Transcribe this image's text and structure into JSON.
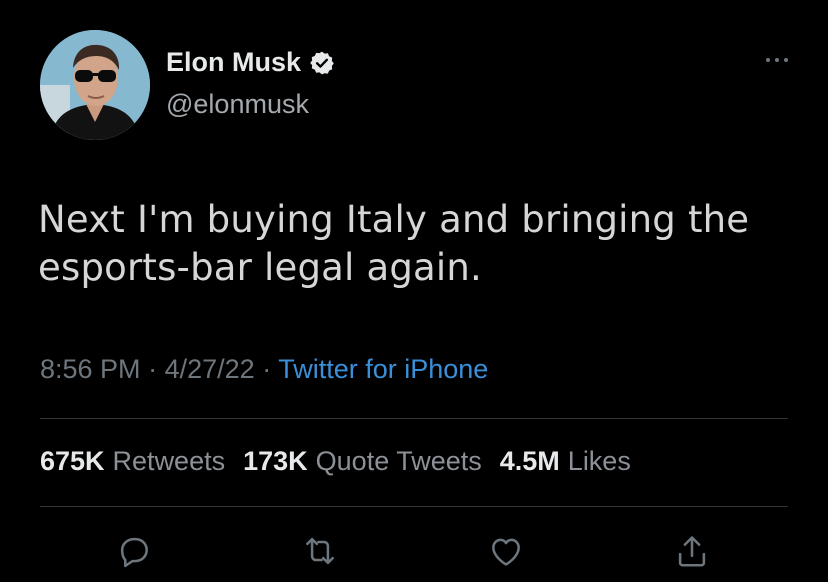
{
  "author": {
    "display_name": "Elon Musk",
    "handle": "@elonmusk",
    "verified": true,
    "avatar_icon": "profile-photo"
  },
  "tweet": {
    "text": "Next I'm buying Italy and bringing the esports-bar legal again.",
    "time": "8:56 PM",
    "date": "4/27/22",
    "separator": "·",
    "source": "Twitter for iPhone"
  },
  "stats": {
    "retweets_count": "675K",
    "retweets_label": "Retweets",
    "quotes_count": "173K",
    "quotes_label": "Quote Tweets",
    "likes_count": "4.5M",
    "likes_label": "Likes"
  },
  "actions": {
    "reply_icon": "reply-icon",
    "retweet_icon": "retweet-icon",
    "like_icon": "like-icon",
    "share_icon": "share-icon"
  },
  "colors": {
    "background": "#000000",
    "link": "#3a8fd8",
    "muted": "#6e767d",
    "verified_badge": "#e7e9ea"
  }
}
